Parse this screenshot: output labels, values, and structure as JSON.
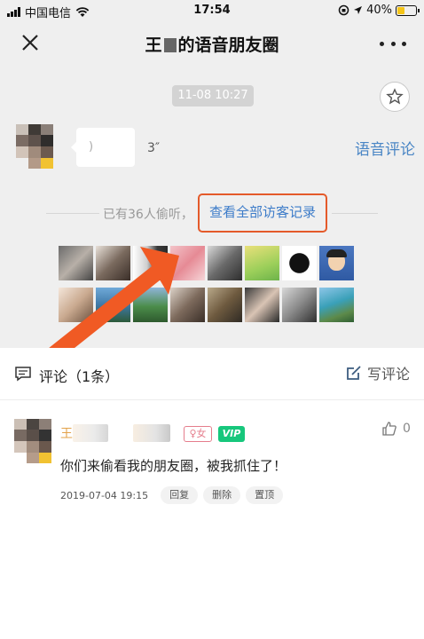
{
  "status_bar": {
    "carrier": "中国电信",
    "time": "17:54",
    "battery": "40%"
  },
  "nav": {
    "title_prefix": "王",
    "title_suffix": "的语音朋友圈"
  },
  "post": {
    "timestamp": "11-08 10:27",
    "voice_duration": "3″",
    "voice_comment_label": "语音评论"
  },
  "visitors": {
    "summary": "已有36人偷听，",
    "view_all_label": "查看全部访客记录"
  },
  "comments": {
    "header_label": "评论（1条）",
    "write_label": "写评论"
  },
  "comment": {
    "author_visible": "王",
    "gender_tag": "♀女",
    "vip_tag": "VIP",
    "like_count": "0",
    "text": "你们来偷看我的朋友圈，被我抓住了！",
    "date": "2019-07-04 19:15",
    "reply_label": "回复",
    "delete_label": "删除",
    "pin_label": "置顶"
  },
  "colors": {
    "link_blue": "#3d7cc9",
    "highlight_orange": "#e45a2a",
    "vip_green": "#17c77c",
    "username_gold": "#e3a24a"
  }
}
